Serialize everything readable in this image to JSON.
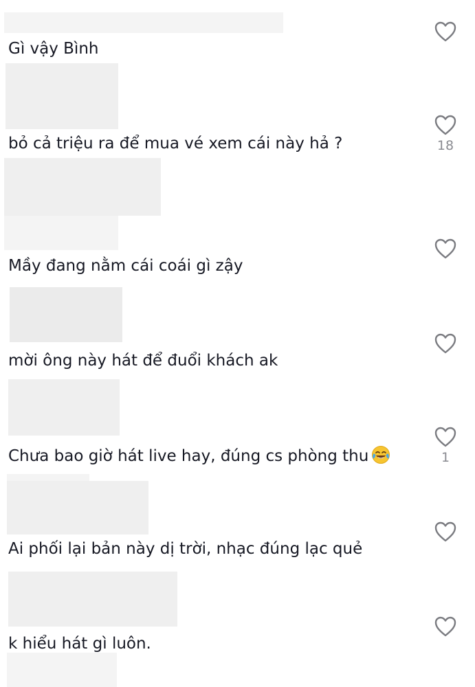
{
  "comments": [
    {
      "text": "Gì vậy Bình",
      "likes": ""
    },
    {
      "text": "bỏ cả triệu ra để mua vé xem cái này hả ?",
      "likes": "18"
    },
    {
      "text": "Mầy đang nằm cái coái gì zậy",
      "likes": ""
    },
    {
      "text": "mời ông này hát để đuổi khách ak",
      "likes": ""
    },
    {
      "text": "Chưa bao giờ hát live hay, đúng cs phòng thu",
      "likes": "1",
      "emoji": "face-with-tears-of-joy-icon"
    },
    {
      "text": "Ai phối lại bản này dị trời, nhạc đúng lạc quẻ",
      "likes": ""
    },
    {
      "text": "k hiểu hát gì luôn.",
      "likes": ""
    }
  ],
  "colors": {
    "text": "#161823",
    "like_count": "#8a8b91",
    "heart_outline": "#7a7b80",
    "blur": "#efefef"
  },
  "icons": {
    "like": "heart-outline-icon"
  }
}
